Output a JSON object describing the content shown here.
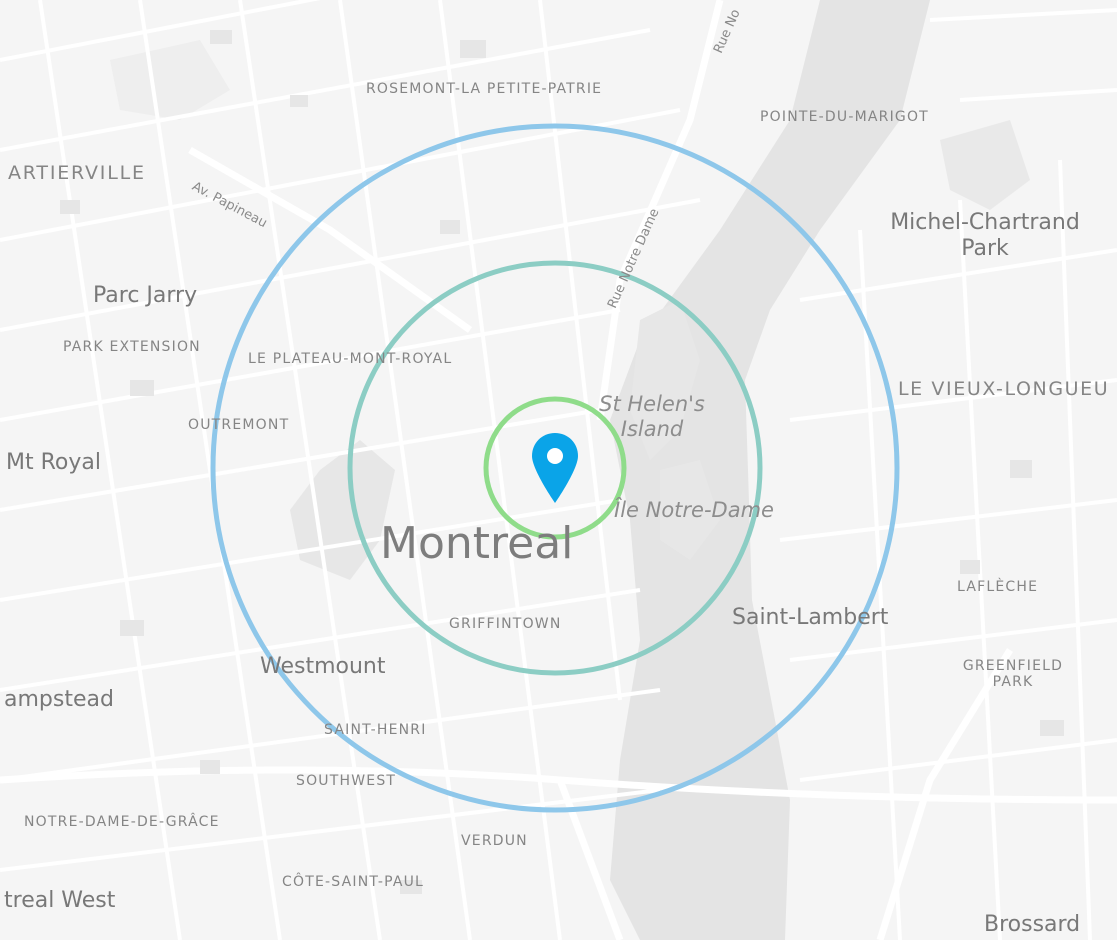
{
  "map": {
    "city": "Montreal",
    "neighborhoods": [
      "ROSEMONT-LA PETITE-PATRIE",
      "POINTE-DU-MARIGOT",
      "PARK EXTENSION",
      "LE PLATEAU-MONT-ROYAL",
      "OUTREMONT",
      "GRIFFINTOWN",
      "LAFLÈCHE",
      "GREENFIELD PARK",
      "SAINT-HENRI",
      "SOUTHWEST",
      "NOTRE-DAME-DE-GRÂCE",
      "VERDUN",
      "CÔTE-SAINT-PAUL",
      "LE VIEUX-LONGUEU"
    ],
    "places": [
      "ARTIERVILLE",
      "Parc Jarry",
      "Mt Royal",
      "Michel-Chartrand Park",
      "Saint-Lambert",
      "Westmount",
      "ampstead",
      "treal West",
      "Brossard"
    ],
    "water": [
      "St Helen's Island",
      "Île Notre-Dame"
    ],
    "streets": [
      "Av. Papineau",
      "Rue Notre Dame",
      "Rue No"
    ],
    "marker_icon": "map-pin-icon",
    "colors": {
      "marker": "#0aa4e8",
      "ring_inner": "#8fdc8a",
      "ring_middle": "#8ccdc4",
      "ring_outer": "#8ec7ea"
    }
  }
}
